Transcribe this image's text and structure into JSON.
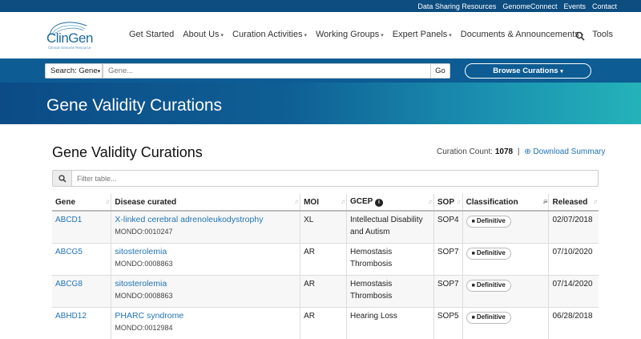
{
  "topbar": {
    "links": [
      "Data Sharing Resources",
      "GenomeConnect",
      "Events",
      "Contact"
    ]
  },
  "logo": {
    "name": "ClinGen",
    "subtitle": "Clinical Genome Resource"
  },
  "nav": {
    "items": [
      {
        "label": "Get Started",
        "caret": false
      },
      {
        "label": "About Us",
        "caret": true
      },
      {
        "label": "Curation Activities",
        "caret": true
      },
      {
        "label": "Working Groups",
        "caret": true
      },
      {
        "label": "Expert Panels",
        "caret": true
      },
      {
        "label": "Documents & Announcements",
        "caret": true
      },
      {
        "label": "Tools",
        "caret": false
      }
    ],
    "search_icon": "search-icon"
  },
  "search": {
    "type_label": "Search: Gene",
    "placeholder": "Gene...",
    "go_label": "Go",
    "browse_label": "Browse Curations"
  },
  "banner": {
    "title": "Gene Validity Curations"
  },
  "content": {
    "title": "Gene Validity Curations",
    "count_label": "Curation Count:",
    "count_value": "1078",
    "download_label": "Download Summary",
    "filter_placeholder": "Filter table..."
  },
  "table": {
    "headers": [
      "Gene",
      "Disease curated",
      "MOI",
      "GCEP",
      "SOP",
      "Classification",
      "Released"
    ],
    "rows": [
      {
        "gene": "ABCD1",
        "disease": "X-linked cerebral adrenoleukodystrophy",
        "mondo": "MONDO:0010247",
        "moi": "XL",
        "gcep": "Intellectual Disability and Autism",
        "sop": "SOP4",
        "classification": "Definitive",
        "released": "02/07/2018"
      },
      {
        "gene": "ABCG5",
        "disease": "sitosterolemia",
        "mondo": "MONDO:0008863",
        "moi": "AR",
        "gcep": "Hemostasis Thrombosis",
        "sop": "SOP7",
        "classification": "Definitive",
        "released": "07/10/2020"
      },
      {
        "gene": "ABCG8",
        "disease": "sitosterolemia",
        "mondo": "MONDO:0008863",
        "moi": "AR",
        "gcep": "Hemostasis Thrombosis",
        "sop": "SOP7",
        "classification": "Definitive",
        "released": "07/14/2020"
      },
      {
        "gene": "ABHD12",
        "disease": "PHARC syndrome",
        "mondo": "MONDO:0012984",
        "moi": "AR",
        "gcep": "Hearing Loss",
        "sop": "SOP5",
        "classification": "Definitive",
        "released": "06/28/2018"
      }
    ]
  },
  "colors": {
    "topbar": "#0d4d80",
    "searchbar": "#0d5c93",
    "link": "#1f73b7",
    "banner_start": "#0c4b86",
    "banner_end": "#24b3b9"
  }
}
